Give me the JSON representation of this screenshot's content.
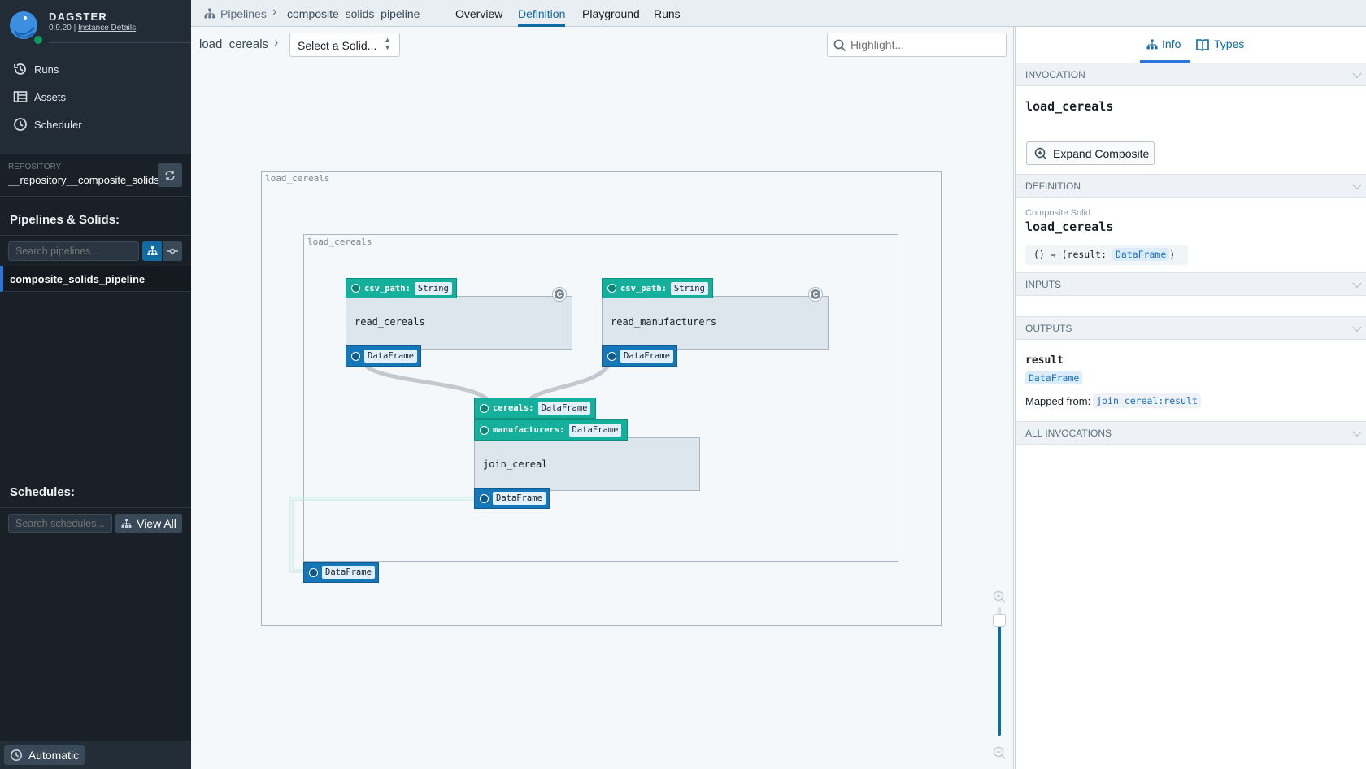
{
  "app": {
    "name": "DAGSTER",
    "version": "0.9.20",
    "instance_link": "Instance Details",
    "status_color": "#0f9960"
  },
  "sidebar": {
    "nav": [
      {
        "label": "Runs",
        "icon": "history-icon"
      },
      {
        "label": "Assets",
        "icon": "table-icon"
      },
      {
        "label": "Scheduler",
        "icon": "clock-icon"
      }
    ],
    "repository_label": "REPOSITORY",
    "repository_name": "__repository__composite_solids",
    "pipelines_heading": "Pipelines & Solids:",
    "pipelines_search_placeholder": "Search pipelines...",
    "pipelines": [
      {
        "label": "composite_solids_pipeline",
        "selected": true
      }
    ],
    "schedules_heading": "Schedules:",
    "schedules_search_placeholder": "Search schedules...",
    "view_all": "View All",
    "footer_button": "Automatic"
  },
  "header": {
    "breadcrumb": [
      "Pipelines",
      "composite_solids_pipeline"
    ],
    "tabs": [
      "Overview",
      "Definition",
      "Playground",
      "Runs"
    ],
    "active_tab": "Definition"
  },
  "toolbar": {
    "crumb": "load_cereals",
    "select_placeholder": "Select a Solid...",
    "highlight_placeholder": "Highlight..."
  },
  "graph": {
    "outer_label": "load_cereals",
    "inner_label": "load_cereals",
    "nodes": [
      {
        "name": "read_cereals",
        "inputs": [
          {
            "name": "csv_path:",
            "type": "String"
          }
        ],
        "output": "DataFrame",
        "config_badge": "C"
      },
      {
        "name": "read_manufacturers",
        "inputs": [
          {
            "name": "csv_path:",
            "type": "String"
          }
        ],
        "output": "DataFrame",
        "config_badge": "C"
      },
      {
        "name": "join_cereal",
        "inputs": [
          {
            "name": "cereals:",
            "type": "DataFrame"
          },
          {
            "name": "manufacturers:",
            "type": "DataFrame"
          }
        ],
        "output": "DataFrame"
      }
    ],
    "composite_output": "DataFrame",
    "zoom_level": 0.95
  },
  "panel": {
    "tabs": [
      "Info",
      "Types"
    ],
    "active_tab": "Info",
    "invocation": {
      "title": "INVOCATION",
      "name": "load_cereals",
      "button": "Expand Composite"
    },
    "definition": {
      "title": "DEFINITION",
      "kind": "Composite Solid",
      "name": "load_cereals",
      "sig_prefix": "() ⇒ (result: ",
      "sig_type": "DataFrame",
      "sig_suffix": ")"
    },
    "inputs": {
      "title": "INPUTS"
    },
    "outputs": {
      "title": "OUTPUTS",
      "name": "result",
      "type": "DataFrame",
      "mapped_label": "Mapped from:",
      "mapped_value": "join_cereal:result"
    },
    "all_invocations": {
      "title": "ALL INVOCATIONS"
    }
  }
}
